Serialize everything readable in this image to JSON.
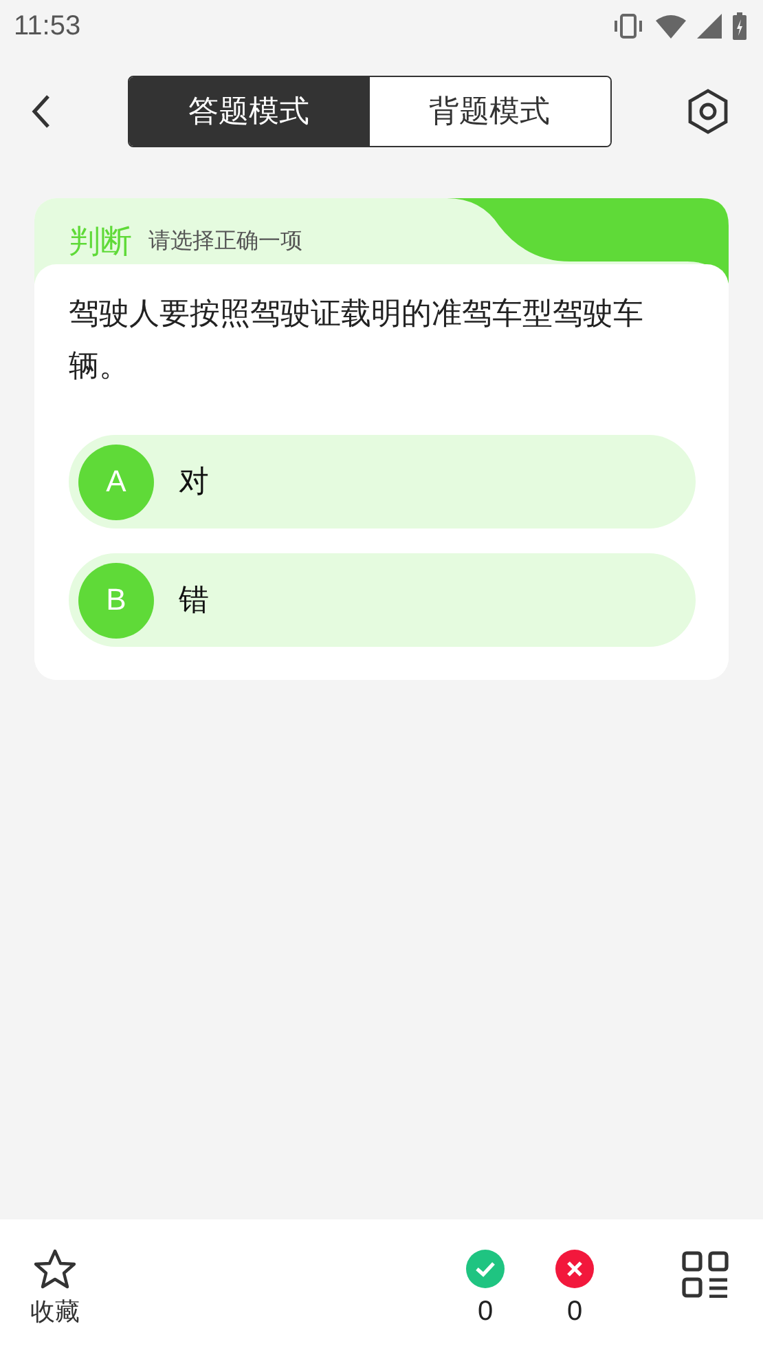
{
  "status_bar": {
    "time": "11:53"
  },
  "tabs": [
    {
      "label": "答题模式",
      "selected": true
    },
    {
      "label": "背题模式",
      "selected": false
    }
  ],
  "question": {
    "type": "判断",
    "hint": "请选择正确一项",
    "text": "驾驶人要按照驾驶证载明的准驾车型驾驶车辆。",
    "options": [
      {
        "letter": "A",
        "text": "对"
      },
      {
        "letter": "B",
        "text": "错"
      }
    ]
  },
  "bottom_bar": {
    "favorite_label": "收藏",
    "correct_count": "0",
    "wrong_count": "0"
  }
}
